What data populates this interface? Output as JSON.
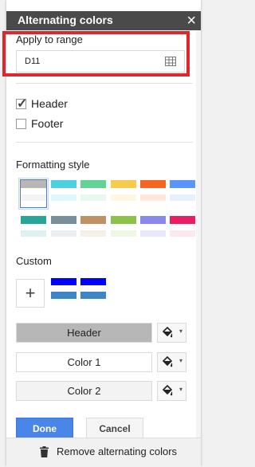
{
  "panel": {
    "title": "Alternating colors",
    "close_glyph": "×"
  },
  "range": {
    "label": "Apply to range",
    "value": "D11",
    "highlight_color": "#e0262b"
  },
  "options": {
    "header_label": "Header",
    "header_checked": true,
    "footer_label": "Footer",
    "footer_checked": false
  },
  "formatting": {
    "label": "Formatting style",
    "styles": [
      {
        "header": "#b7b7b7",
        "band1": "#ffffff",
        "band2": "#f3f3f3"
      },
      {
        "header": "#4dd0e1",
        "band1": "#ffffff",
        "band2": "#e0f7fa"
      },
      {
        "header": "#63d297",
        "band1": "#ffffff",
        "band2": "#e7f9ef"
      },
      {
        "header": "#f7cb4d",
        "band1": "#ffffff",
        "band2": "#fef8e3"
      },
      {
        "header": "#f46524",
        "band1": "#ffffff",
        "band2": "#ffe6dd"
      },
      {
        "header": "#5b95f9",
        "band1": "#ffffff",
        "band2": "#e8f0fe"
      },
      {
        "header": "#26a69a",
        "band1": "#ffffff",
        "band2": "#ddf2f0"
      },
      {
        "header": "#78909c",
        "band1": "#ffffff",
        "band2": "#ebeff1"
      },
      {
        "header": "#bf9264",
        "band1": "#ffffff",
        "band2": "#f6efe7"
      },
      {
        "header": "#8bc34a",
        "band1": "#ffffff",
        "band2": "#eef7e3"
      },
      {
        "header": "#8989eb",
        "band1": "#ffffff",
        "band2": "#e8e7fc"
      },
      {
        "header": "#e91d63",
        "band1": "#ffffff",
        "band2": "#fde8ef"
      }
    ]
  },
  "custom": {
    "label": "Custom",
    "plus_glyph": "+",
    "styles": [
      {
        "header": "#0000ff",
        "band1": "#ffffff",
        "band2": "#3d85c6"
      },
      {
        "header": "#0000ff",
        "band1": "#ffffff",
        "band2": "#3d85c6"
      }
    ]
  },
  "colors": {
    "header_label": "Header",
    "header_bg": "#b7b7b7",
    "color1_label": "Color 1",
    "color1_bg": "#ffffff",
    "color2_label": "Color 2",
    "color2_bg": "#f3f3f3",
    "bucket_icon": "paint-bucket-icon",
    "caret_glyph": "▾"
  },
  "actions": {
    "done_label": "Done",
    "done_color": "#4a86e8",
    "cancel_label": "Cancel",
    "remove_label": "Remove alternating colors"
  }
}
